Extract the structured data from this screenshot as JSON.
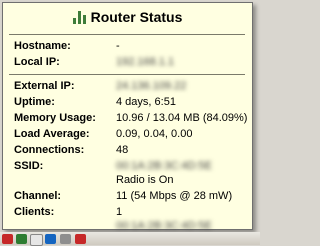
{
  "tooltip": {
    "title": "Router Status",
    "rows": [
      {
        "label": "Hostname:",
        "value": "-"
      },
      {
        "label": "Local IP:",
        "value": "192.168.1.1"
      },
      {
        "label": "External IP:",
        "value": "24.136.109.22"
      },
      {
        "label": "Uptime:",
        "value": "4 days, 6:51"
      },
      {
        "label": "Memory Usage:",
        "value": "10.96 / 13.04 MB (84.09%)"
      },
      {
        "label": "Load Average:",
        "value": "0.09, 0.04, 0.00"
      },
      {
        "label": "Connections:",
        "value": "48"
      },
      {
        "label": "SSID:",
        "value": "00:1A:2B:3C:4D:5E"
      },
      {
        "label": "",
        "value": "Radio is On"
      },
      {
        "label": "Channel:",
        "value": "11 (54 Mbps @ 28 mW)"
      },
      {
        "label": "Clients:",
        "value": "1"
      },
      {
        "label": "",
        "value": "00:1A:2B:3C:4D:5E"
      }
    ]
  },
  "taskbar": {
    "icons": [
      "app-icon",
      "security-icon",
      "network-icon",
      "update-icon",
      "volume-icon",
      "alert-icon"
    ]
  },
  "colors": {
    "tooltip_background": "#ffffe1",
    "icon_green": "#3e7d3a"
  }
}
